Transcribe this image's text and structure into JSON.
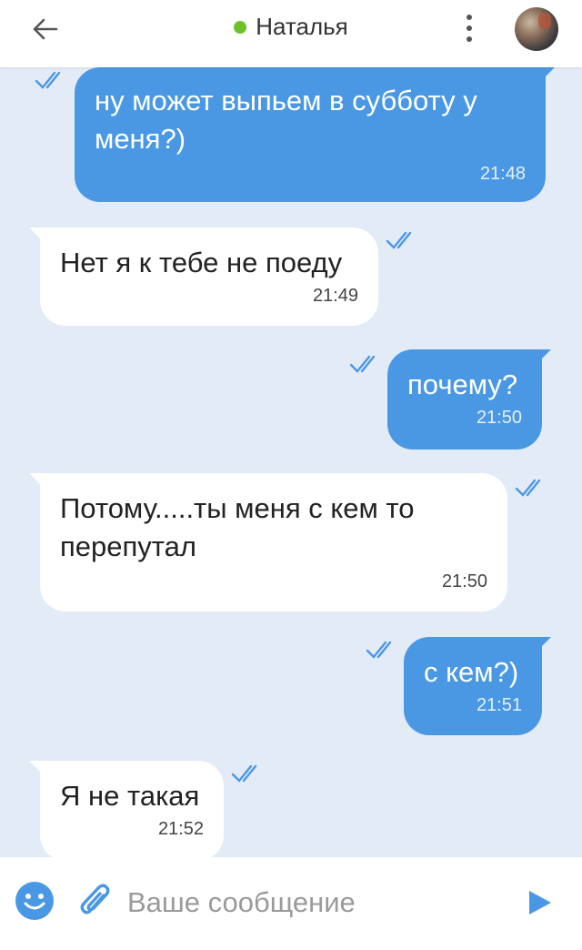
{
  "header": {
    "contact_name": "Наталья",
    "online": true,
    "online_color": "#6cc22a"
  },
  "messages": [
    {
      "direction": "out",
      "text": "ну может выпьем в субботу у меня?)",
      "time": "21:48",
      "read": true
    },
    {
      "direction": "in",
      "text": "Нет я к тебе не поеду",
      "time": "21:49",
      "read": true
    },
    {
      "direction": "out",
      "text": "почему?",
      "time": "21:50",
      "read": true
    },
    {
      "direction": "in",
      "text": "Потому.....ты меня с кем то перепутал",
      "time": "21:50",
      "read": true
    },
    {
      "direction": "out",
      "text": "с кем?)",
      "time": "21:51",
      "read": true
    },
    {
      "direction": "in",
      "text": "Я не такая",
      "time": "21:52",
      "read": true
    }
  ],
  "composer": {
    "placeholder": "Ваше сообщение",
    "value": ""
  },
  "colors": {
    "outgoing_bubble": "#4a98e3",
    "incoming_bubble": "#ffffff",
    "chat_background": "#e3ebf7",
    "accent": "#4a98e3"
  },
  "icons": {
    "back": "arrow-left-icon",
    "menu": "more-vert-icon",
    "emoji": "smile-icon",
    "attach": "paperclip-icon",
    "send": "send-icon",
    "read": "double-check-icon"
  }
}
